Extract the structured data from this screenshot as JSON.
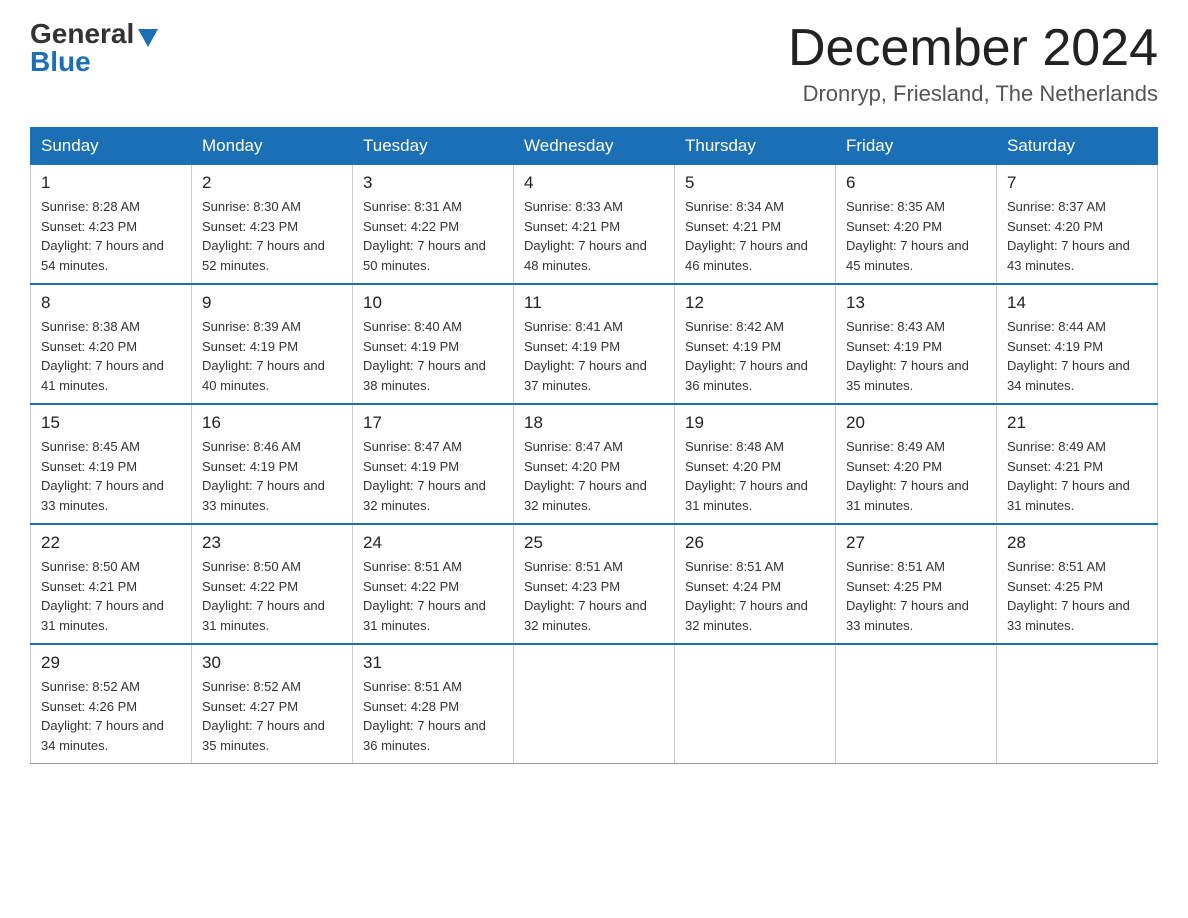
{
  "header": {
    "logo_general": "General",
    "logo_blue": "Blue",
    "month_title": "December 2024",
    "location": "Dronryp, Friesland, The Netherlands"
  },
  "weekdays": [
    "Sunday",
    "Monday",
    "Tuesday",
    "Wednesday",
    "Thursday",
    "Friday",
    "Saturday"
  ],
  "weeks": [
    [
      {
        "day": "1",
        "sunrise": "8:28 AM",
        "sunset": "4:23 PM",
        "daylight": "7 hours and 54 minutes."
      },
      {
        "day": "2",
        "sunrise": "8:30 AM",
        "sunset": "4:23 PM",
        "daylight": "7 hours and 52 minutes."
      },
      {
        "day": "3",
        "sunrise": "8:31 AM",
        "sunset": "4:22 PM",
        "daylight": "7 hours and 50 minutes."
      },
      {
        "day": "4",
        "sunrise": "8:33 AM",
        "sunset": "4:21 PM",
        "daylight": "7 hours and 48 minutes."
      },
      {
        "day": "5",
        "sunrise": "8:34 AM",
        "sunset": "4:21 PM",
        "daylight": "7 hours and 46 minutes."
      },
      {
        "day": "6",
        "sunrise": "8:35 AM",
        "sunset": "4:20 PM",
        "daylight": "7 hours and 45 minutes."
      },
      {
        "day": "7",
        "sunrise": "8:37 AM",
        "sunset": "4:20 PM",
        "daylight": "7 hours and 43 minutes."
      }
    ],
    [
      {
        "day": "8",
        "sunrise": "8:38 AM",
        "sunset": "4:20 PM",
        "daylight": "7 hours and 41 minutes."
      },
      {
        "day": "9",
        "sunrise": "8:39 AM",
        "sunset": "4:19 PM",
        "daylight": "7 hours and 40 minutes."
      },
      {
        "day": "10",
        "sunrise": "8:40 AM",
        "sunset": "4:19 PM",
        "daylight": "7 hours and 38 minutes."
      },
      {
        "day": "11",
        "sunrise": "8:41 AM",
        "sunset": "4:19 PM",
        "daylight": "7 hours and 37 minutes."
      },
      {
        "day": "12",
        "sunrise": "8:42 AM",
        "sunset": "4:19 PM",
        "daylight": "7 hours and 36 minutes."
      },
      {
        "day": "13",
        "sunrise": "8:43 AM",
        "sunset": "4:19 PM",
        "daylight": "7 hours and 35 minutes."
      },
      {
        "day": "14",
        "sunrise": "8:44 AM",
        "sunset": "4:19 PM",
        "daylight": "7 hours and 34 minutes."
      }
    ],
    [
      {
        "day": "15",
        "sunrise": "8:45 AM",
        "sunset": "4:19 PM",
        "daylight": "7 hours and 33 minutes."
      },
      {
        "day": "16",
        "sunrise": "8:46 AM",
        "sunset": "4:19 PM",
        "daylight": "7 hours and 33 minutes."
      },
      {
        "day": "17",
        "sunrise": "8:47 AM",
        "sunset": "4:19 PM",
        "daylight": "7 hours and 32 minutes."
      },
      {
        "day": "18",
        "sunrise": "8:47 AM",
        "sunset": "4:20 PM",
        "daylight": "7 hours and 32 minutes."
      },
      {
        "day": "19",
        "sunrise": "8:48 AM",
        "sunset": "4:20 PM",
        "daylight": "7 hours and 31 minutes."
      },
      {
        "day": "20",
        "sunrise": "8:49 AM",
        "sunset": "4:20 PM",
        "daylight": "7 hours and 31 minutes."
      },
      {
        "day": "21",
        "sunrise": "8:49 AM",
        "sunset": "4:21 PM",
        "daylight": "7 hours and 31 minutes."
      }
    ],
    [
      {
        "day": "22",
        "sunrise": "8:50 AM",
        "sunset": "4:21 PM",
        "daylight": "7 hours and 31 minutes."
      },
      {
        "day": "23",
        "sunrise": "8:50 AM",
        "sunset": "4:22 PM",
        "daylight": "7 hours and 31 minutes."
      },
      {
        "day": "24",
        "sunrise": "8:51 AM",
        "sunset": "4:22 PM",
        "daylight": "7 hours and 31 minutes."
      },
      {
        "day": "25",
        "sunrise": "8:51 AM",
        "sunset": "4:23 PM",
        "daylight": "7 hours and 32 minutes."
      },
      {
        "day": "26",
        "sunrise": "8:51 AM",
        "sunset": "4:24 PM",
        "daylight": "7 hours and 32 minutes."
      },
      {
        "day": "27",
        "sunrise": "8:51 AM",
        "sunset": "4:25 PM",
        "daylight": "7 hours and 33 minutes."
      },
      {
        "day": "28",
        "sunrise": "8:51 AM",
        "sunset": "4:25 PM",
        "daylight": "7 hours and 33 minutes."
      }
    ],
    [
      {
        "day": "29",
        "sunrise": "8:52 AM",
        "sunset": "4:26 PM",
        "daylight": "7 hours and 34 minutes."
      },
      {
        "day": "30",
        "sunrise": "8:52 AM",
        "sunset": "4:27 PM",
        "daylight": "7 hours and 35 minutes."
      },
      {
        "day": "31",
        "sunrise": "8:51 AM",
        "sunset": "4:28 PM",
        "daylight": "7 hours and 36 minutes."
      },
      null,
      null,
      null,
      null
    ]
  ]
}
